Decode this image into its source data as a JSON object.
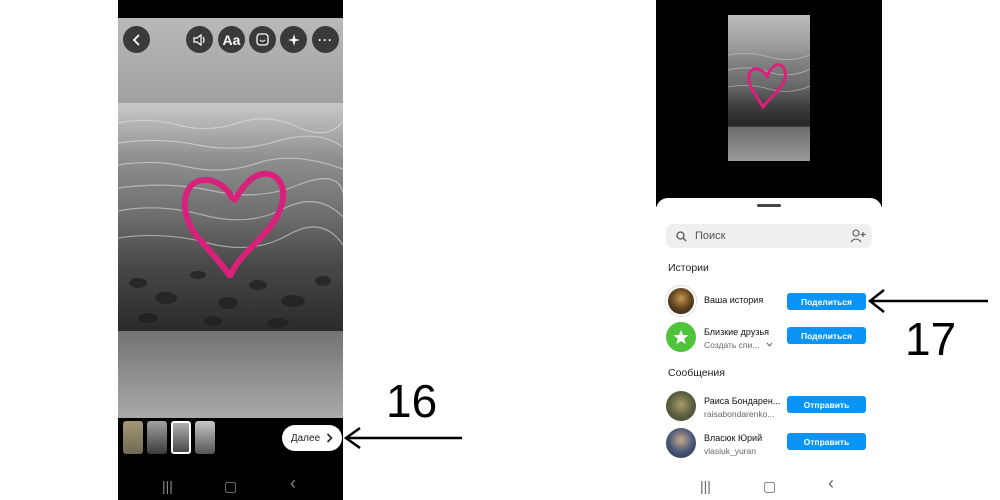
{
  "editor": {
    "top_icons": [
      "back-arrow-icon",
      "volume-icon",
      "text-icon",
      "sticker-icon",
      "sparkle-icon",
      "more-icon"
    ],
    "text_button_label": "Aa",
    "heart_color": "#d8217a",
    "next_button_label": "Далее",
    "thumbnail_count": 4
  },
  "annotations": {
    "left_number": "16",
    "right_number": "17"
  },
  "share_sheet": {
    "search_placeholder": "Поиск",
    "stories_section_title": "Истории",
    "stories": [
      {
        "label": "Ваша история",
        "sub": "",
        "button": "Поделиться"
      },
      {
        "label": "Близкие друзья",
        "sub": "Создать спи...",
        "button": "Поделиться"
      }
    ],
    "messages_section_title": "Сообщения",
    "messages": [
      {
        "name": "Раиса Бондарен...",
        "handle": "raisabondarenko...",
        "button": "Отправить"
      },
      {
        "name": "Власюк Юрий",
        "handle": "vlasiuk_yuran",
        "button": "Отправить"
      }
    ],
    "accent_color": "#0a95f6",
    "close_friends_color": "#4fc43a"
  },
  "system_nav": {
    "recents_glyph": "|||",
    "home_glyph": "▢",
    "back_glyph": "‹"
  }
}
